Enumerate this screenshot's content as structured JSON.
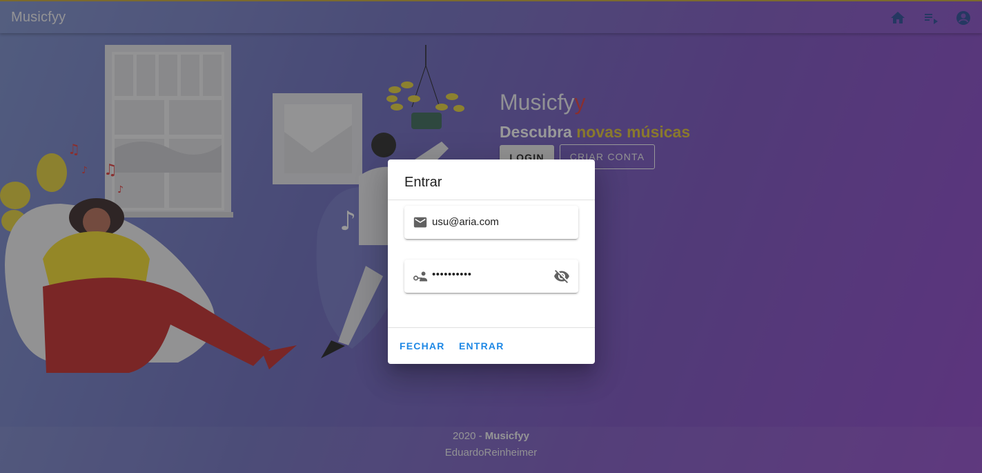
{
  "app": {
    "title": "Musicfyy"
  },
  "appbar": {
    "icons": [
      "home-icon",
      "playlist-icon",
      "account-icon"
    ]
  },
  "hero": {
    "title_main": "Musicfy",
    "title_accent": "y",
    "subtitle_plain": "Descubra ",
    "subtitle_highlight": "novas músicas",
    "login_label": "LOGIN",
    "create_label": "CRIAR CONTA"
  },
  "footer": {
    "year_prefix": "2020 - ",
    "brand": "Musicfyy",
    "author": "EduardoReinheimer"
  },
  "dialog": {
    "title": "Entrar",
    "email_value": "usu@aria.com",
    "password_value": "••••••••••",
    "close_label": "FECHAR",
    "submit_label": "ENTRAR"
  },
  "colors": {
    "accent_red": "#e23b3b",
    "accent_gold": "#e2c438",
    "action_blue": "#1e88e5"
  }
}
